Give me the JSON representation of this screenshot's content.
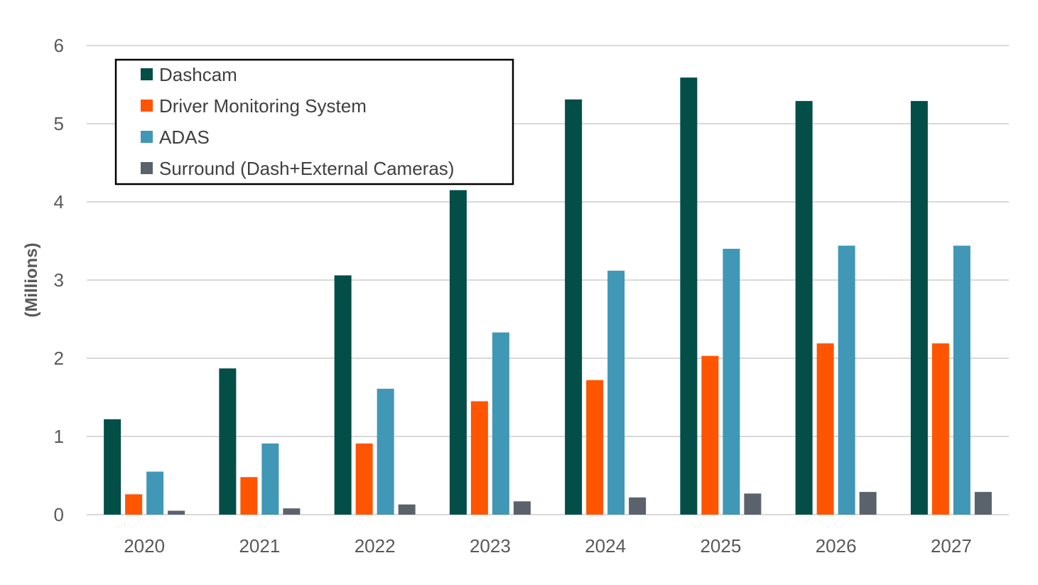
{
  "chart_data": {
    "type": "bar",
    "title": "",
    "xlabel": "",
    "ylabel": "(Millions)",
    "ylim": [
      0,
      6
    ],
    "yticks": [
      0,
      1,
      2,
      3,
      4,
      5,
      6
    ],
    "grid": true,
    "legend_position": "top-left",
    "categories": [
      "2020",
      "2021",
      "2022",
      "2023",
      "2024",
      "2025",
      "2026",
      "2027"
    ],
    "series": [
      {
        "name": "Dashcam",
        "color": "#044E48",
        "values": [
          1.22,
          1.87,
          3.06,
          4.15,
          5.31,
          5.59,
          5.29,
          5.29
        ]
      },
      {
        "name": "Driver Monitoring System",
        "color": "#FF5500",
        "values": [
          0.26,
          0.48,
          0.91,
          1.45,
          1.72,
          2.03,
          2.19,
          2.19
        ]
      },
      {
        "name": "ADAS",
        "color": "#4097B6",
        "values": [
          0.55,
          0.91,
          1.61,
          2.33,
          3.12,
          3.4,
          3.44,
          3.44
        ]
      },
      {
        "name": "Surround (Dash+External Cameras)",
        "color": "#5A626B",
        "values": [
          0.05,
          0.08,
          0.13,
          0.17,
          0.22,
          0.27,
          0.29,
          0.29
        ]
      }
    ]
  }
}
